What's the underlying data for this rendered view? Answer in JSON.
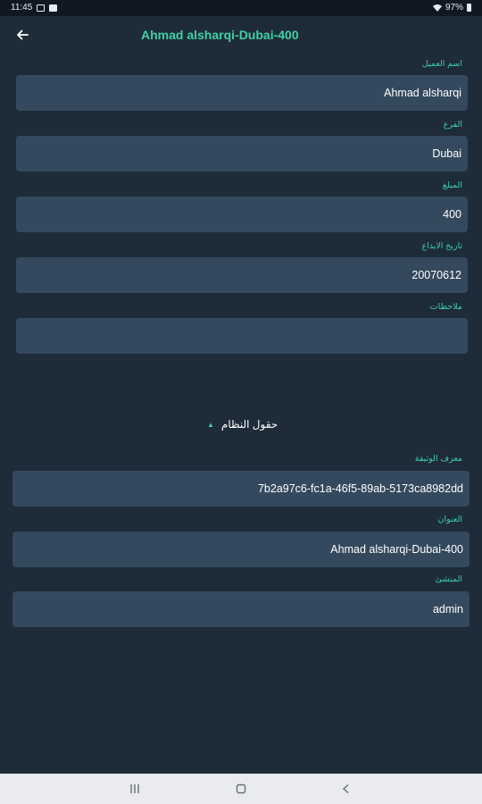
{
  "status_bar": {
    "time": "11:45",
    "battery": "97%"
  },
  "header": {
    "title": "Ahmad alsharqi-Dubai-400"
  },
  "form": {
    "customer_name": {
      "label": "اسم العميل",
      "value": "Ahmad alsharqi"
    },
    "branch": {
      "label": "الفرع",
      "value": "Dubai"
    },
    "amount": {
      "label": "المبلغ",
      "value": "400"
    },
    "deposit_date": {
      "label": "تاريخ الايداع",
      "value": "20070612"
    },
    "notes": {
      "label": "ملاحظات",
      "value": ""
    }
  },
  "system_fields": {
    "toggle_label": "حقول النظام",
    "document_id": {
      "label": "معرف الوثيقة",
      "value": "7b2a97c6-fc1a-46f5-89ab-5173ca8982dd"
    },
    "title": {
      "label": "العنوان",
      "value": "Ahmad alsharqi-Dubai-400"
    },
    "owner": {
      "label": "المنشئ",
      "value": "admin"
    }
  },
  "colors": {
    "accent": "#3fd0a7",
    "background": "#1e2b38",
    "field": "#34495e"
  }
}
